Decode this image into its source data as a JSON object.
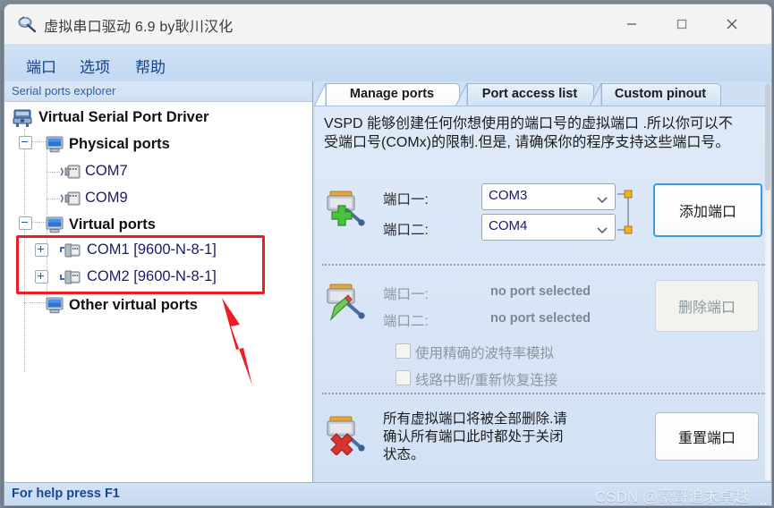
{
  "window": {
    "title": "虚拟串口驱动 6.9 by耿川汉化",
    "icon": "app-icon",
    "controls": {
      "minimize": "minimize-icon",
      "maximize": "maximize-icon",
      "close": "close-icon"
    }
  },
  "menu": {
    "items": [
      "端口",
      "选项",
      "帮助"
    ]
  },
  "tree": {
    "header": "Serial ports explorer",
    "root": "Virtual Serial Port Driver",
    "groups": [
      {
        "label": "Physical ports",
        "children": [
          "COM7",
          "COM9"
        ]
      },
      {
        "label": "Virtual ports",
        "children": [
          "COM1 [9600-N-8-1]",
          "COM2 [9600-N-8-1]"
        ]
      }
    ],
    "other": "Other virtual ports"
  },
  "tabs": [
    {
      "label": "Manage ports",
      "active": true
    },
    {
      "label": "Port access list",
      "active": false
    },
    {
      "label": "Custom pinout",
      "active": false
    }
  ],
  "manage": {
    "description_line1": "VSPD 能够创建任何你想使用的端口号的虚拟端口 .所以你可以不",
    "description_line2": "受端口号(COMx)的限制.但是, 请确保你的程序支持这些端口号。",
    "add_section": {
      "icon": "port-add-icon",
      "label_port1": "端口一:",
      "label_port2": "端口二:",
      "port1_value": "COM3",
      "port2_value": "COM4",
      "button": "添加端口"
    },
    "delete_section": {
      "icon": "port-edit-icon",
      "label_port1": "端口一:",
      "label_port2": "端口二:",
      "port1_value": "no port selected",
      "port2_value": "no port selected",
      "checkbox1": "使用精确的波特率模拟",
      "checkbox2": "线路中断/重新恢复连接",
      "button": "删除端口"
    },
    "reset_section": {
      "icon": "port-delete-icon",
      "text_line1": "所有虚拟端口将被全部删除.请",
      "text_line2": "确认所有端口此时都处于关闭",
      "text_line3": "状态。",
      "button": "重置端口"
    }
  },
  "statusbar": {
    "text": "For help press F1"
  },
  "watermark": {
    "text": "CSDN @豪哥追求卓越"
  },
  "annotations": {
    "highlight_box": "red-highlight-rectangle",
    "arrow": "red-arrow"
  },
  "colors": {
    "accent": "#15428b",
    "annotation": "#ee1c25",
    "focus": "#3c9ae0"
  }
}
